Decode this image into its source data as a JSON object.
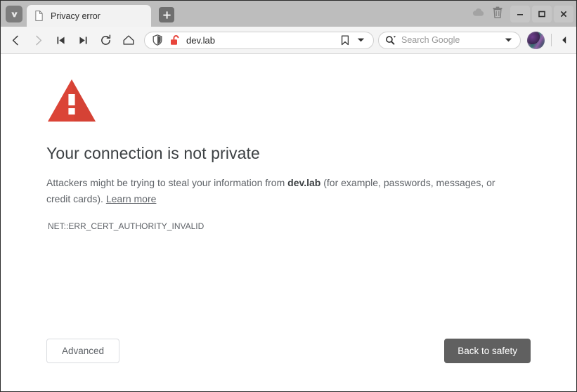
{
  "window": {
    "tab": {
      "title": "Privacy error",
      "favicon_icon": "page-document-icon"
    },
    "browser_menu_icon": "vivaldi-logo-icon",
    "new_tab_icon": "plus-icon",
    "status_icons": [
      {
        "name": "sync-cloud-icon",
        "label": "Sync"
      },
      {
        "name": "trash-icon",
        "label": "Trash"
      }
    ],
    "controls": [
      {
        "name": "minimize-button",
        "glyph": "–"
      },
      {
        "name": "maximize-button",
        "glyph": "□"
      },
      {
        "name": "close-button",
        "glyph": "✕"
      }
    ]
  },
  "toolbar": {
    "nav": [
      {
        "name": "back-button",
        "icon": "chevron-left-icon"
      },
      {
        "name": "forward-button",
        "icon": "chevron-right-icon"
      },
      {
        "name": "rewind-button",
        "icon": "skip-previous-icon"
      },
      {
        "name": "fastforward-button",
        "icon": "skip-next-icon"
      },
      {
        "name": "reload-button",
        "icon": "reload-icon"
      },
      {
        "name": "home-button",
        "icon": "home-icon"
      }
    ],
    "address": {
      "shield_icon": "shield-icon",
      "security_icon": "unlocked-padlock-icon",
      "security_state": "not-secure",
      "url": "dev.lab",
      "bookmark_icon": "bookmark-icon",
      "dropdown_icon": "chevron-down-icon"
    },
    "search": {
      "engine_icon": "search-magnifier-icon",
      "placeholder": "Search Google",
      "value": "",
      "dropdown_icon": "chevron-down-icon"
    },
    "profile": {
      "name": "profile-avatar",
      "label": "Profile"
    },
    "panel_toggle_icon": "panel-collapse-left-icon"
  },
  "page": {
    "warning_icon": "warning-triangle-icon",
    "title": "Your connection is not private",
    "body_prefix": "Attackers might be trying to steal your information from ",
    "body_domain": "dev.lab",
    "body_suffix": " (for example, passwords, messages, or credit cards). ",
    "learn_more": "Learn more",
    "error_code": "NET::ERR_CERT_AUTHORITY_INVALID",
    "advanced_button": "Advanced",
    "back_to_safety_button": "Back to safety"
  },
  "colors": {
    "warning_red": "#db4437",
    "padlock_red": "#e8453c",
    "tabbar_gray": "#bdbdbd",
    "toolbar_gray": "#f4f4f4",
    "primary_button": "#606060",
    "text_secondary": "#5f6368"
  }
}
